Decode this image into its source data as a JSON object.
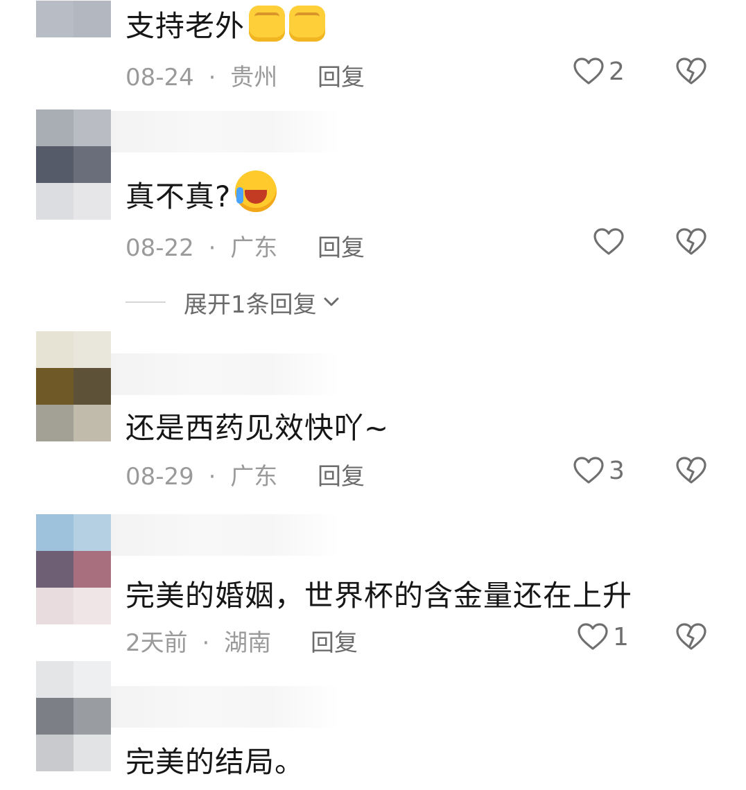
{
  "comments": [
    {
      "text": "支持老外",
      "emoji": [
        "fist",
        "fist"
      ],
      "date": "08-24",
      "region": "贵州",
      "reply_label": "回复",
      "likes": "2"
    },
    {
      "text": "真不真?",
      "emoji": [
        "laugh-cry"
      ],
      "date": "08-22",
      "region": "广东",
      "reply_label": "回复",
      "likes": ""
    },
    {
      "text": "还是西药见效快吖~",
      "date": "08-29",
      "region": "广东",
      "reply_label": "回复",
      "likes": "3"
    },
    {
      "text": "完美的婚姻，世界杯的含金量还在上升",
      "date": "2天前",
      "region": "湖南",
      "reply_label": "回复",
      "likes": "1"
    },
    {
      "text": "完美的结局。"
    }
  ],
  "expand_replies_label": "展开1条回复",
  "separator": "·",
  "icons": {
    "like": "heart-outline-icon",
    "dislike": "broken-heart-icon",
    "expand": "chevron-down-icon"
  },
  "colors": {
    "text": "#161616",
    "meta": "#9a9a9a",
    "icon": "#6f6f6f"
  }
}
